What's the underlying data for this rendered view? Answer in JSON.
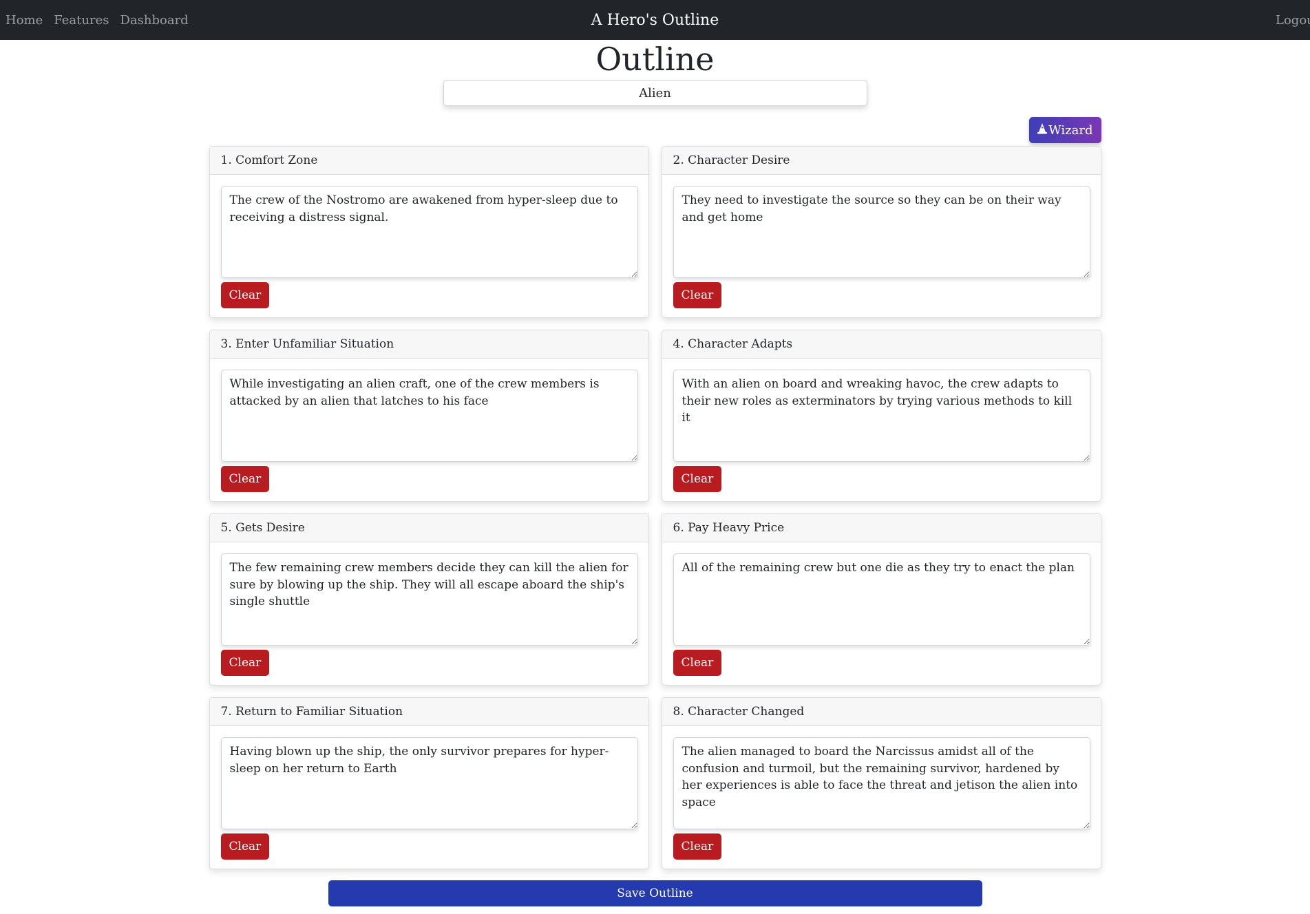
{
  "nav": {
    "links": [
      {
        "label": "Home"
      },
      {
        "label": "Features"
      },
      {
        "label": "Dashboard"
      }
    ],
    "brand": "A Hero's Outline",
    "logout": "Logou"
  },
  "page": {
    "title": "Outline",
    "story_title_value": "Alien"
  },
  "wizard": {
    "icon": "wizard-hat-icon",
    "label": "Wizard"
  },
  "cards": [
    {
      "title": "1. Comfort Zone",
      "text": "The crew of the Nostromo are awakened from hyper-sleep due to receiving a distress signal.",
      "clear_label": "Clear"
    },
    {
      "title": "2. Character Desire",
      "text": "They need to investigate the source so they can be on their way and get home",
      "clear_label": "Clear"
    },
    {
      "title": "3. Enter Unfamiliar Situation",
      "text": "While investigating an alien craft, one of the crew members is attacked by an alien that latches to his face",
      "clear_label": "Clear"
    },
    {
      "title": "4. Character Adapts",
      "text": "With an alien on board and wreaking havoc, the crew adapts to their new roles as exterminators by trying various methods to kill it",
      "clear_label": "Clear"
    },
    {
      "title": "5. Gets Desire",
      "text": "The few remaining crew members decide they can kill the alien for sure by blowing up the ship. They will all escape aboard the ship's single shuttle",
      "clear_label": "Clear"
    },
    {
      "title": "6. Pay Heavy Price",
      "text": "All of the remaining crew but one die as they try to enact the plan",
      "clear_label": "Clear"
    },
    {
      "title": "7. Return to Familiar Situation",
      "text": "Having blown up the ship, the only survivor prepares for hyper-sleep on her return to Earth",
      "clear_label": "Clear"
    },
    {
      "title": "8. Character Changed",
      "text": "The alien managed to board the Narcissus amidst all of the confusion and turmoil, but the remaining survivor, hardened by her experiences is able to face the threat and jetison the alien into space",
      "clear_label": "Clear"
    }
  ],
  "save": {
    "label": "Save Outline"
  },
  "colors": {
    "navbar_bg": "#212529",
    "clear_button": "#b81c20",
    "save_button": "#243aae",
    "wizard_gradient_start": "#3d3fb8",
    "wizard_gradient_end": "#7b37b5"
  }
}
